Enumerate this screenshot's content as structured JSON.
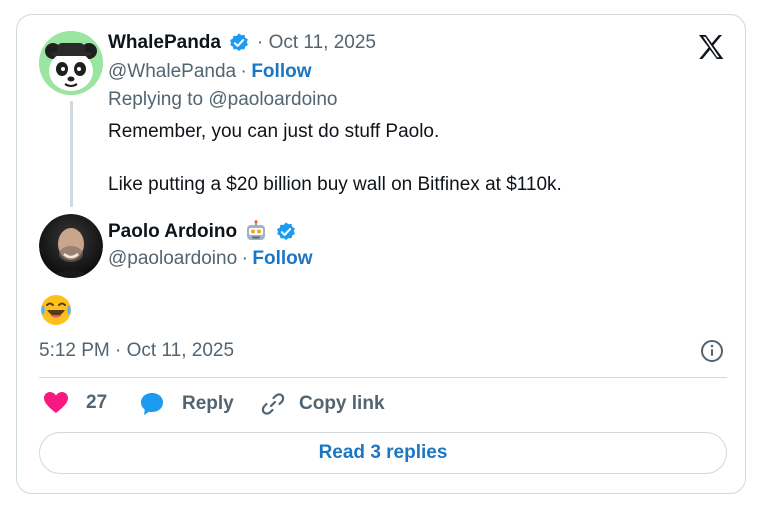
{
  "tweet_parent": {
    "display_name": "WhalePanda",
    "date": "· Oct 11, 2025",
    "handle": "@WhalePanda",
    "follow_sep": "·",
    "follow_label": "Follow",
    "replying_to": "Replying to @paoloardoino",
    "body_line1": "Remember, you can just do stuff Paolo.",
    "body_line2": "Like putting a $20 billion buy wall on Bitfinex at $110k."
  },
  "tweet_reply": {
    "display_name": "Paolo Ardoino",
    "handle": "@paoloardoino",
    "follow_sep": "·",
    "follow_label": "Follow",
    "emoji": "😂",
    "timestamp": "5:12 PM · Oct 11, 2025"
  },
  "actions": {
    "like_count": "27",
    "reply_label": "Reply",
    "copy_label": "Copy link"
  },
  "read_replies_label": "Read 3 replies",
  "colors": {
    "accent": "#1d76c2",
    "like": "#f91880",
    "border": "#cfd9de",
    "muted": "#536471",
    "text": "#0f1419"
  },
  "icons": {
    "verified": "verified-badge-icon",
    "x_logo": "x-logo-icon",
    "info": "info-icon",
    "heart": "heart-icon",
    "reply": "speech-bubble-icon",
    "copy": "link-icon",
    "robot": "robot-emoji-icon"
  }
}
